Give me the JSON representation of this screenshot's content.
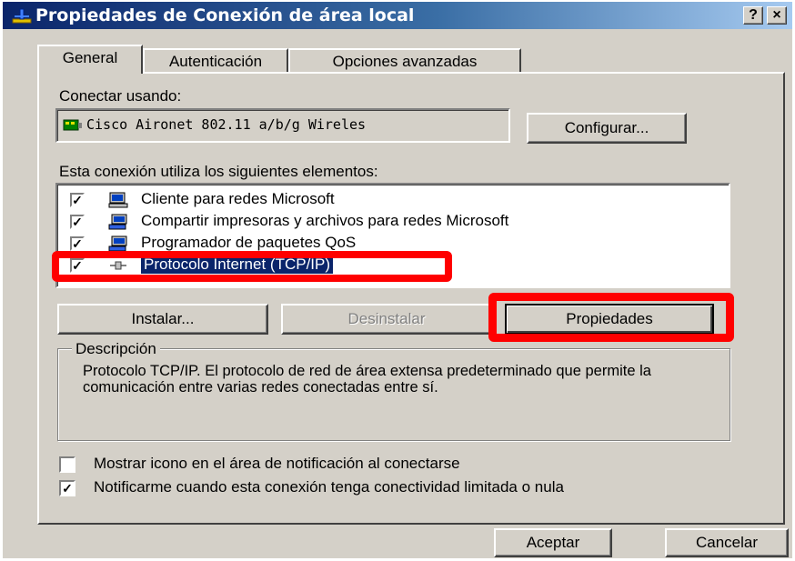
{
  "window": {
    "title": "Propiedades de Conexión de área local",
    "help_button": "?",
    "close_button": "×"
  },
  "tabs": [
    {
      "label": "General",
      "selected": true
    },
    {
      "label": "Autenticación",
      "selected": false
    },
    {
      "label": "Opciones avanzadas",
      "selected": false
    }
  ],
  "connect_using": {
    "label": "Conectar usando:",
    "adapter_name": "Cisco Aironet 802.11 a/b/g Wireles",
    "configure_button": "Configurar..."
  },
  "components": {
    "label": "Esta conexión utiliza los siguientes elementos:",
    "items": [
      {
        "label": "Cliente para redes Microsoft",
        "checked": true,
        "icon": "client-network-icon",
        "selected": false
      },
      {
        "label": "Compartir impresoras y archivos para redes Microsoft",
        "checked": true,
        "icon": "file-printer-share-icon",
        "selected": false
      },
      {
        "label": "Programador de paquetes QoS",
        "checked": true,
        "icon": "qos-scheduler-icon",
        "selected": false
      },
      {
        "label": "Protocolo Internet (TCP/IP)",
        "checked": true,
        "icon": "protocol-icon",
        "selected": true
      }
    ],
    "install_button": "Instalar...",
    "uninstall_button": "Desinstalar",
    "properties_button": "Propiedades"
  },
  "description": {
    "legend": "Descripción",
    "text": "Protocolo TCP/IP. El protocolo de red de área extensa predeterminado que permite la comunicación entre varias redes conectadas entre sí."
  },
  "options": [
    {
      "label": "Mostrar icono en el área de notificación al conectarse",
      "checked": false
    },
    {
      "label": "Notificarme cuando esta conexión tenga conectividad limitada o nula",
      "checked": true
    }
  ],
  "footer": {
    "ok_button": "Aceptar",
    "cancel_button": "Cancelar"
  },
  "colors": {
    "titlebar_start": "#0a246a",
    "titlebar_end": "#a6caf0",
    "selection": "#0a246a",
    "annotation_red": "#ff0000",
    "face": "#d4d0c8"
  }
}
